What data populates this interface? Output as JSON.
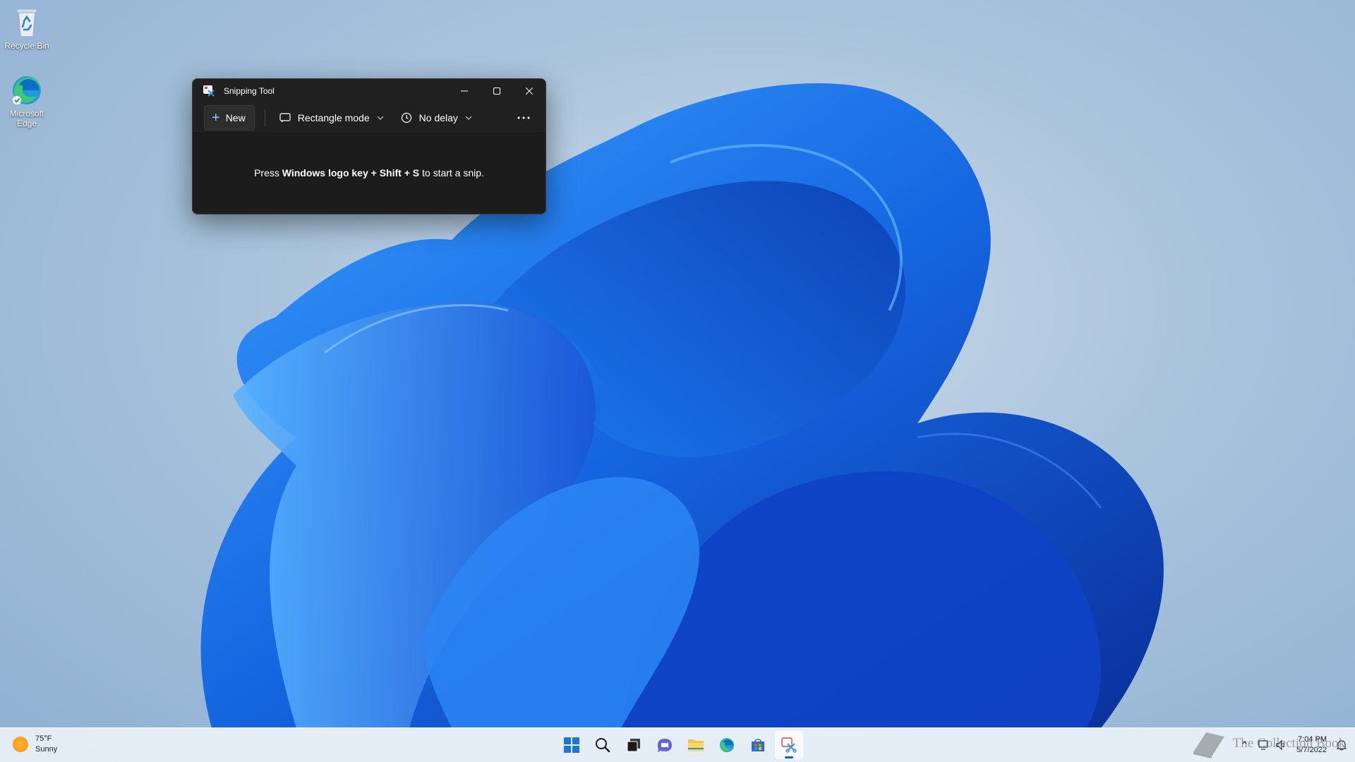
{
  "desktop": {
    "icons": [
      {
        "label": "Recycle Bin",
        "icon": "recycle-bin-icon"
      },
      {
        "label": "Microsoft Edge",
        "icon": "edge-icon"
      }
    ]
  },
  "window": {
    "title": "Snipping Tool",
    "app_icon": "snipping-tool-icon",
    "controls": [
      "minimize-icon",
      "maximize-icon",
      "close-icon"
    ],
    "toolbar": {
      "new_label": "New",
      "mode_label": "Rectangle mode",
      "delay_label": "No delay",
      "more_icon": "more-icon"
    },
    "message": {
      "prefix": "Press ",
      "keys": "Windows logo key + Shift + S",
      "suffix": " to start a snip."
    }
  },
  "taskbar": {
    "weather": {
      "temp": "75°F",
      "condition": "Sunny"
    },
    "pinned": [
      "start-icon",
      "search-icon",
      "task-view-icon",
      "teams-chat-icon",
      "file-explorer-icon",
      "edge-icon",
      "store-icon",
      "snipping-tool-icon"
    ],
    "active": "snipping-tool-icon",
    "clock": {
      "time": "7:04 PM",
      "date": "5/7/2022"
    }
  },
  "watermark": {
    "text": "The Collection Book"
  },
  "colors": {
    "accent": "#0067c0",
    "window_bg": "#202020",
    "wallpaper_blue": "#1a6fe8"
  }
}
